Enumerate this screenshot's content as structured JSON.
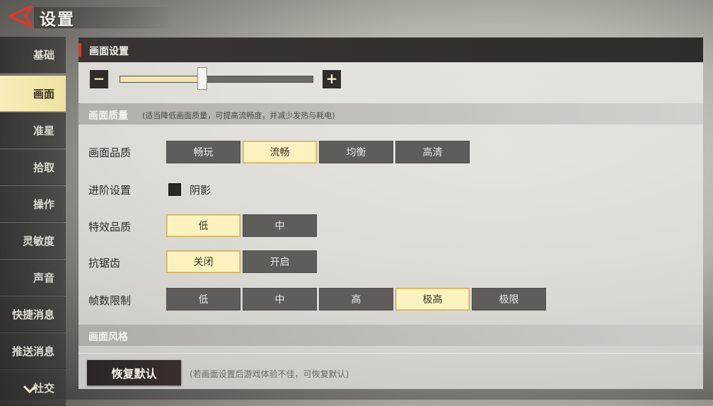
{
  "header": {
    "title": "设置"
  },
  "sidebar": {
    "items": [
      {
        "label": "基础"
      },
      {
        "label": "画面"
      },
      {
        "label": "准星"
      },
      {
        "label": "拾取"
      },
      {
        "label": "操作"
      },
      {
        "label": "灵敏度"
      },
      {
        "label": "声音"
      },
      {
        "label": "快捷消息"
      },
      {
        "label": "推送消息"
      },
      {
        "label": "社交"
      }
    ],
    "active_index": 1
  },
  "panel": {
    "title": "画面设置",
    "brightness": {
      "minus": "−",
      "plus": "+",
      "level": 0.43
    },
    "quality_section": {
      "title": "画面质量",
      "note": "(适当降低画面质量，可提高流畅度，并减少发热与耗电)"
    },
    "rows": {
      "picture_quality": {
        "label": "画面品质",
        "options": [
          "畅玩",
          "流畅",
          "均衡",
          "高清"
        ],
        "selected": 1
      },
      "advanced": {
        "label": "进阶设置",
        "checkbox_label": "阴影",
        "checked": false
      },
      "effects_quality": {
        "label": "特效品质",
        "options": [
          "低",
          "中"
        ],
        "selected": 0
      },
      "anti_aliasing": {
        "label": "抗锯齿",
        "options": [
          "关闭",
          "开启"
        ],
        "selected": 0
      },
      "frame_limit": {
        "label": "帧数限制",
        "options": [
          "低",
          "中",
          "高",
          "极高",
          "极限"
        ],
        "selected": 3
      }
    },
    "style_section": {
      "title": "画面风格"
    },
    "reset": {
      "label": "恢复默认",
      "note": "(若画面设置后游戏体验不佳，可恢复默认)"
    }
  },
  "colors": {
    "accent_red": "#d43a2f",
    "selected_fill": "#fbf2c0",
    "option_fill": "#5f5c59"
  }
}
